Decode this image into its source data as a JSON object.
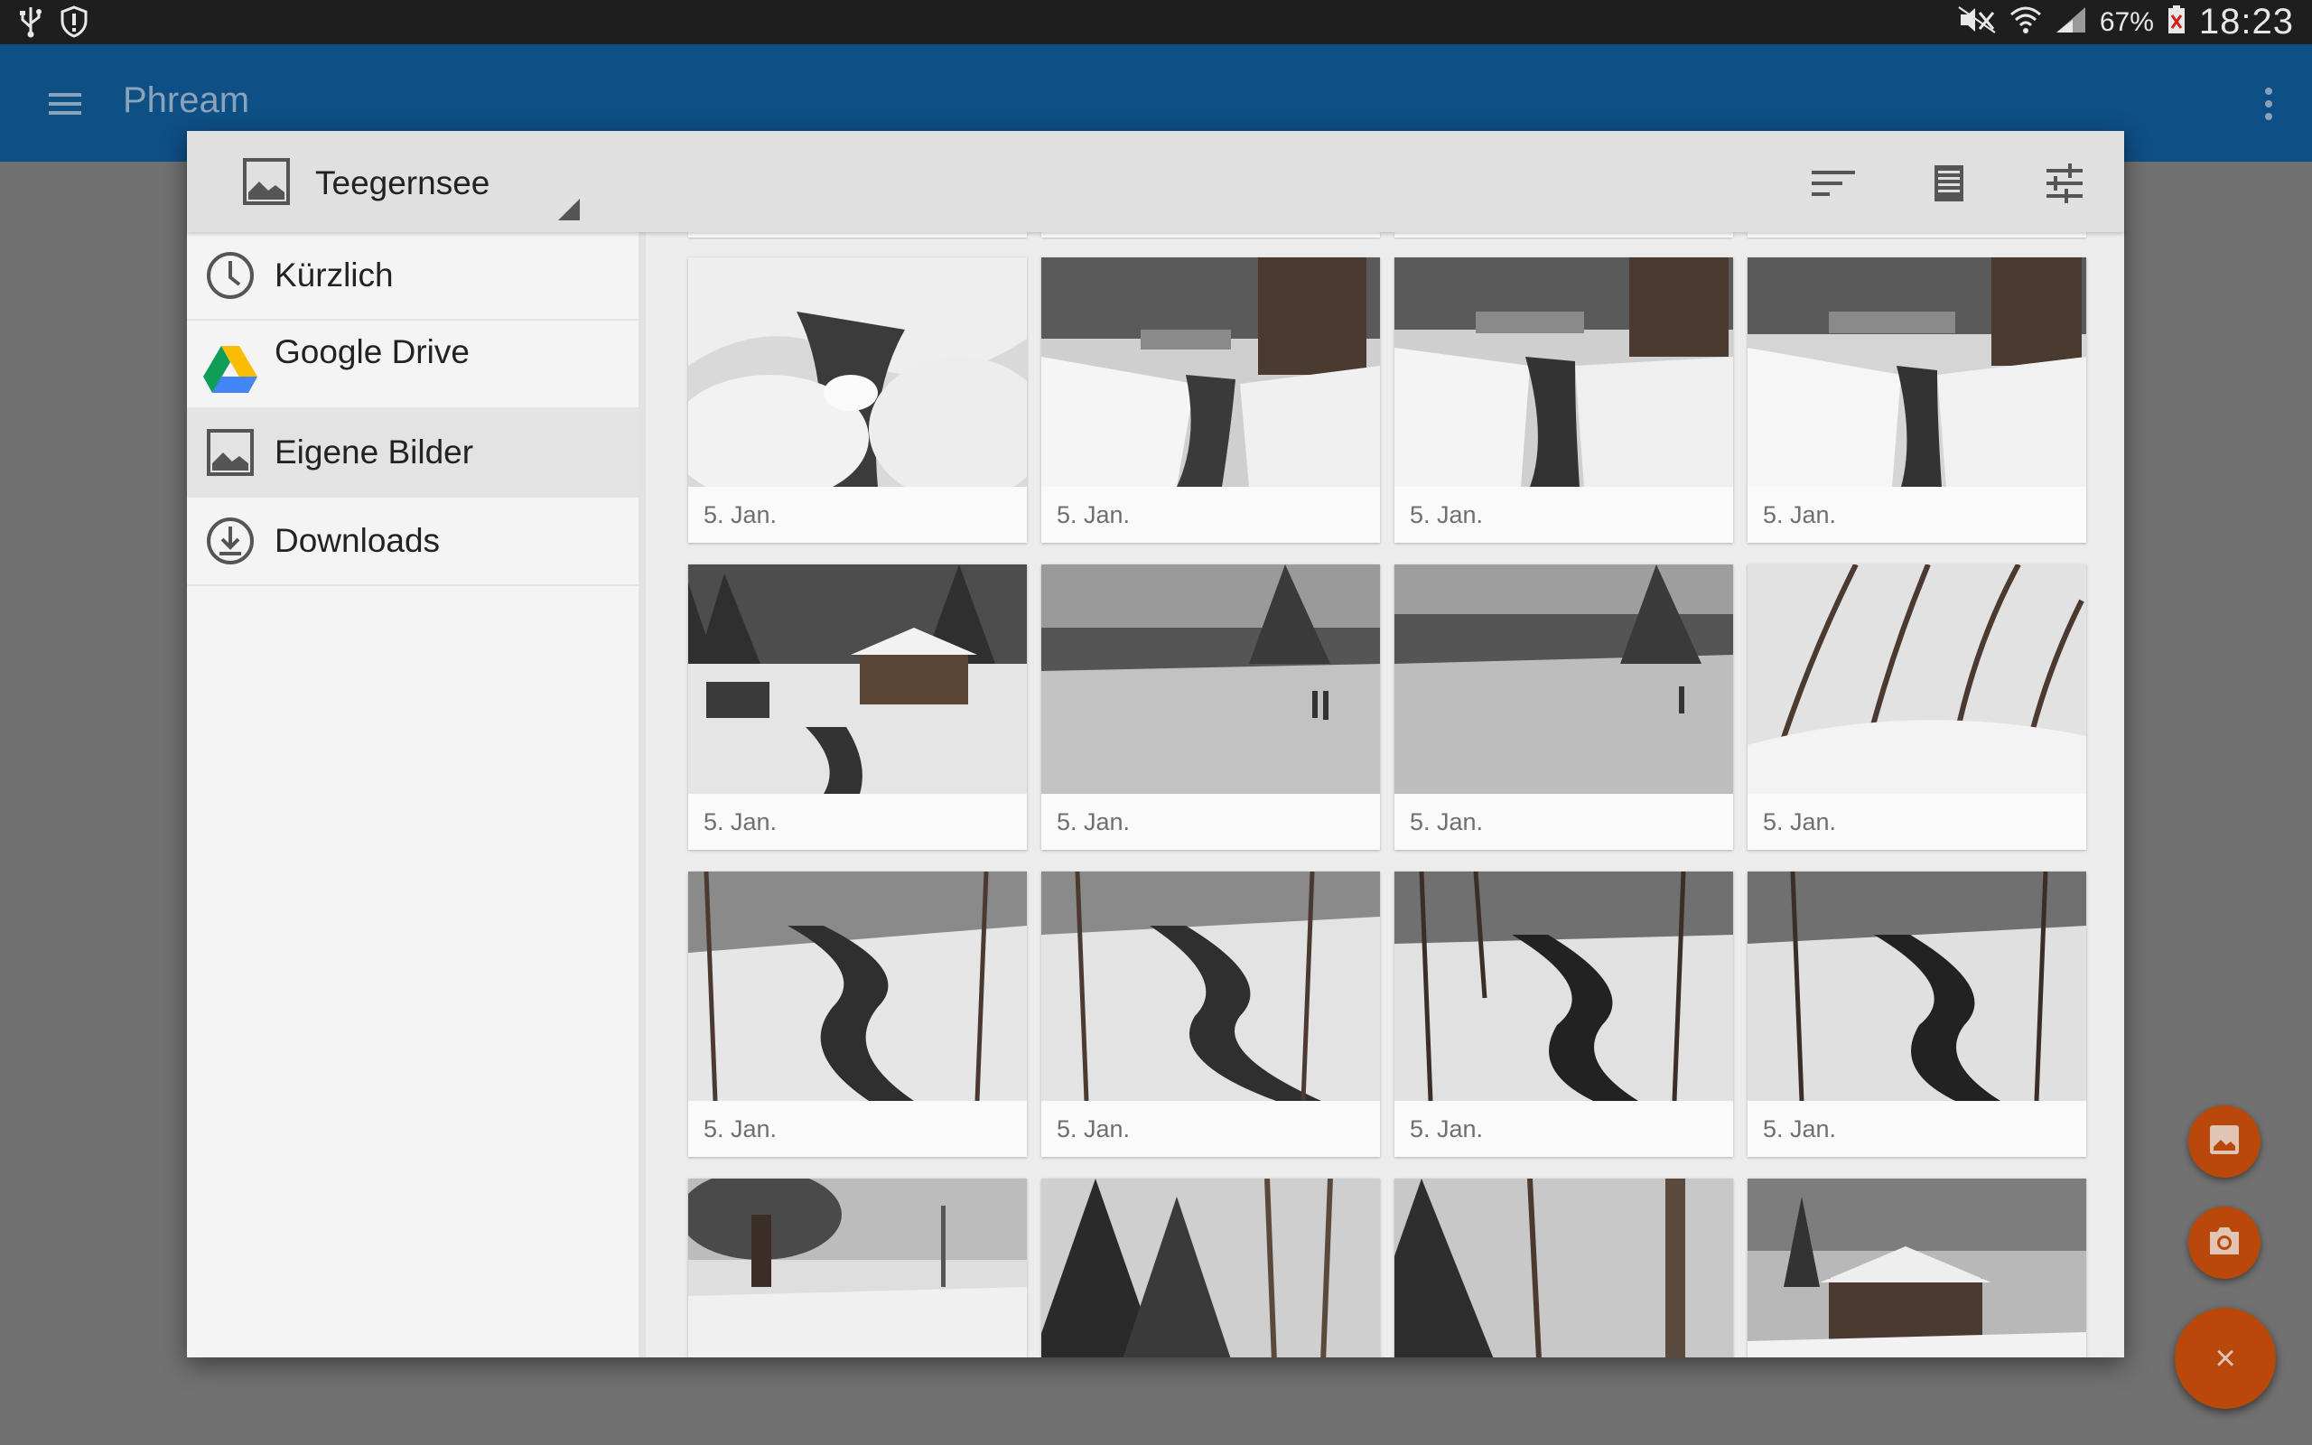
{
  "status_bar": {
    "battery": "67%",
    "time": "18:23",
    "left_icons": [
      "usb-icon",
      "shield-alert-icon"
    ],
    "right_icons": [
      "mute-icon",
      "wifi-icon",
      "signal-icon",
      "battery-icon"
    ]
  },
  "app_bar": {
    "title": "Phream",
    "menu_icon": "hamburger-icon",
    "overflow_icon": "more-vert-icon",
    "color": "#0e4f86"
  },
  "picker": {
    "folder": "Teegernsee",
    "folder_icon": "image-icon",
    "header_icons": [
      "sort-icon",
      "list-view-icon",
      "tune-icon"
    ],
    "sidebar": [
      {
        "label": "Kürzlich",
        "icon": "clock-icon",
        "selected": false
      },
      {
        "label": "Google Drive",
        "icon": "google-drive-icon",
        "selected": false
      },
      {
        "label": "Eigene Bilder",
        "icon": "image-icon",
        "selected": true
      },
      {
        "label": "Downloads",
        "icon": "download-icon",
        "selected": false
      }
    ],
    "photos": [
      {
        "date": "5. Jan."
      },
      {
        "date": "5. Jan."
      },
      {
        "date": "5. Jan."
      },
      {
        "date": "5. Jan."
      },
      {
        "date": "5. Jan."
      },
      {
        "date": "5. Jan."
      },
      {
        "date": "5. Jan."
      },
      {
        "date": "5. Jan."
      },
      {
        "date": "5. Jan."
      },
      {
        "date": "5. Jan."
      },
      {
        "date": "5. Jan."
      },
      {
        "date": "5. Jan."
      },
      {
        "date": ""
      },
      {
        "date": ""
      },
      {
        "date": ""
      },
      {
        "date": ""
      }
    ]
  },
  "fabs": {
    "gallery_icon": "image-icon",
    "camera_icon": "camera-icon",
    "close_label": "×",
    "accent": "#b9480a"
  }
}
